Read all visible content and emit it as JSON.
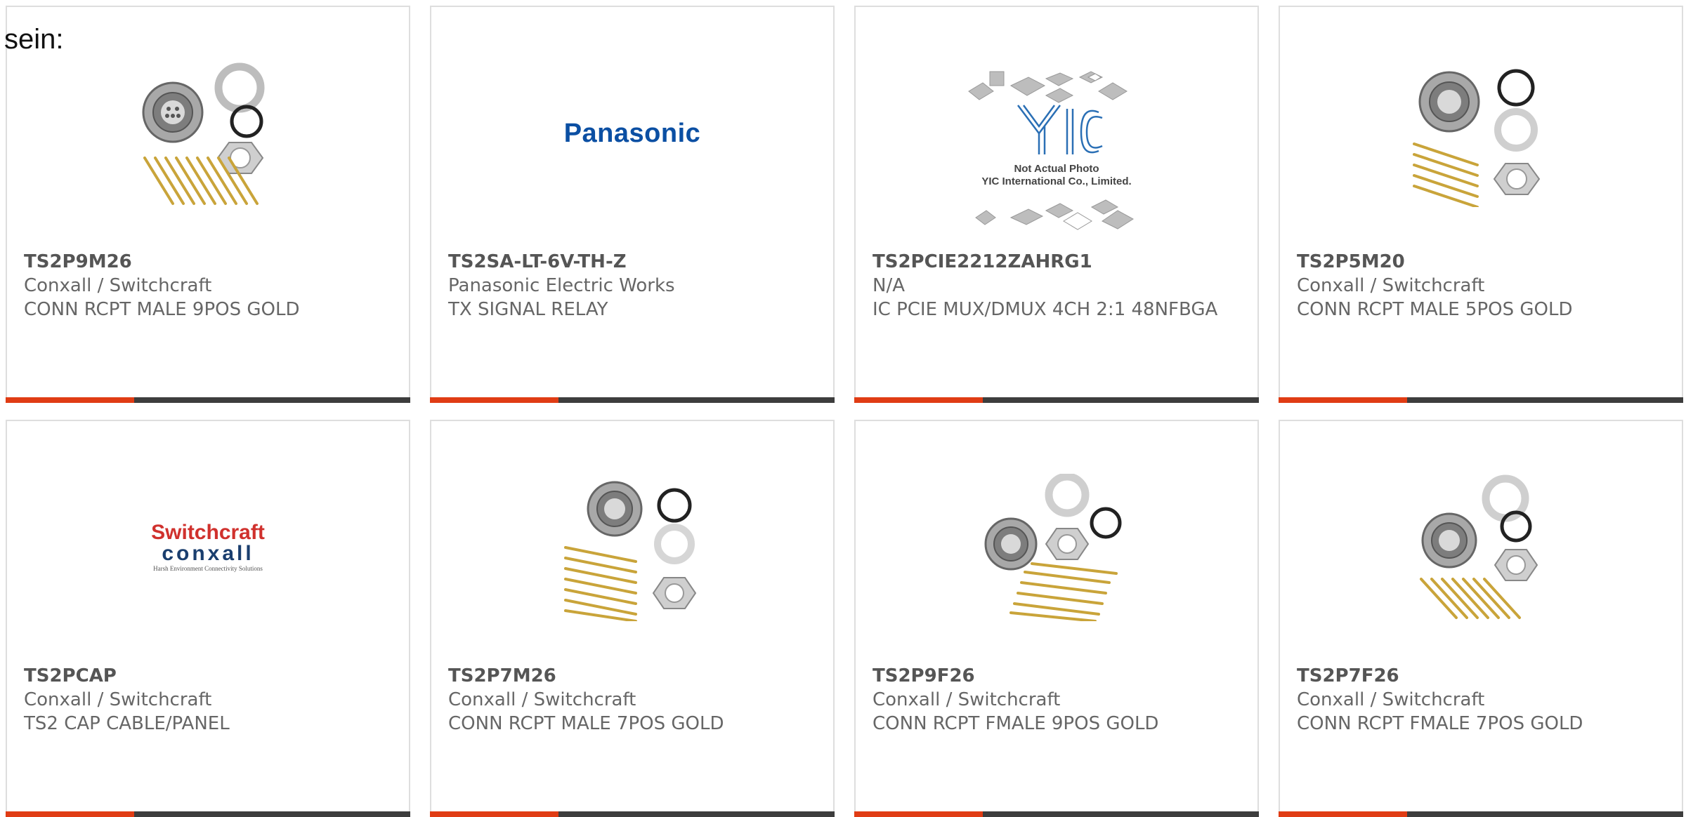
{
  "intro_text": "sein:",
  "colors": {
    "card_border": "#dedede",
    "bar_dark": "#3d3d3d",
    "bar_accent": "#e03c14",
    "text": "#666666",
    "part_number": "#555555"
  },
  "products": [
    {
      "part_number": "TS2P9M26",
      "manufacturer": "Conxall / Switchcraft",
      "description": "CONN RCPT MALE 9POS GOLD",
      "image": "connector-9pin-kit-photo"
    },
    {
      "part_number": "TS2SA-LT-6V-TH-Z",
      "manufacturer": "Panasonic Electric Works",
      "description": "TX SIGNAL RELAY",
      "image": "panasonic-logo",
      "logo_text": "Panasonic"
    },
    {
      "part_number": "TS2PCIE2212ZAHRG1",
      "manufacturer": "N/A",
      "description": "IC PCIE MUX/DMUX 4CH 2:1 48NFBGA",
      "image": "yic-placeholder",
      "placeholder_line1": "Not Actual Photo",
      "placeholder_line2": "YIC International Co., Limited."
    },
    {
      "part_number": "TS2P5M20",
      "manufacturer": "Conxall / Switchcraft",
      "description": "CONN RCPT MALE 5POS GOLD",
      "image": "connector-5pin-kit-photo"
    },
    {
      "part_number": "TS2PCAP",
      "manufacturer": "Conxall / Switchcraft",
      "description": "TS2 CAP CABLE/PANEL",
      "image": "switchcraft-conxall-logo",
      "logo_line1": "Switchcraft",
      "logo_line2": "conxall",
      "logo_line3": "Harsh Environment Connectivity Solutions"
    },
    {
      "part_number": "TS2P7M26",
      "manufacturer": "Conxall / Switchcraft",
      "description": "CONN RCPT MALE 7POS GOLD",
      "image": "connector-7pin-kit-photo"
    },
    {
      "part_number": "TS2P9F26",
      "manufacturer": "Conxall / Switchcraft",
      "description": "CONN RCPT FMALE 9POS GOLD",
      "image": "connector-9pin-female-kit-photo"
    },
    {
      "part_number": "TS2P7F26",
      "manufacturer": "Conxall / Switchcraft",
      "description": "CONN RCPT FMALE 7POS GOLD",
      "image": "connector-7pin-female-kit-photo"
    }
  ]
}
